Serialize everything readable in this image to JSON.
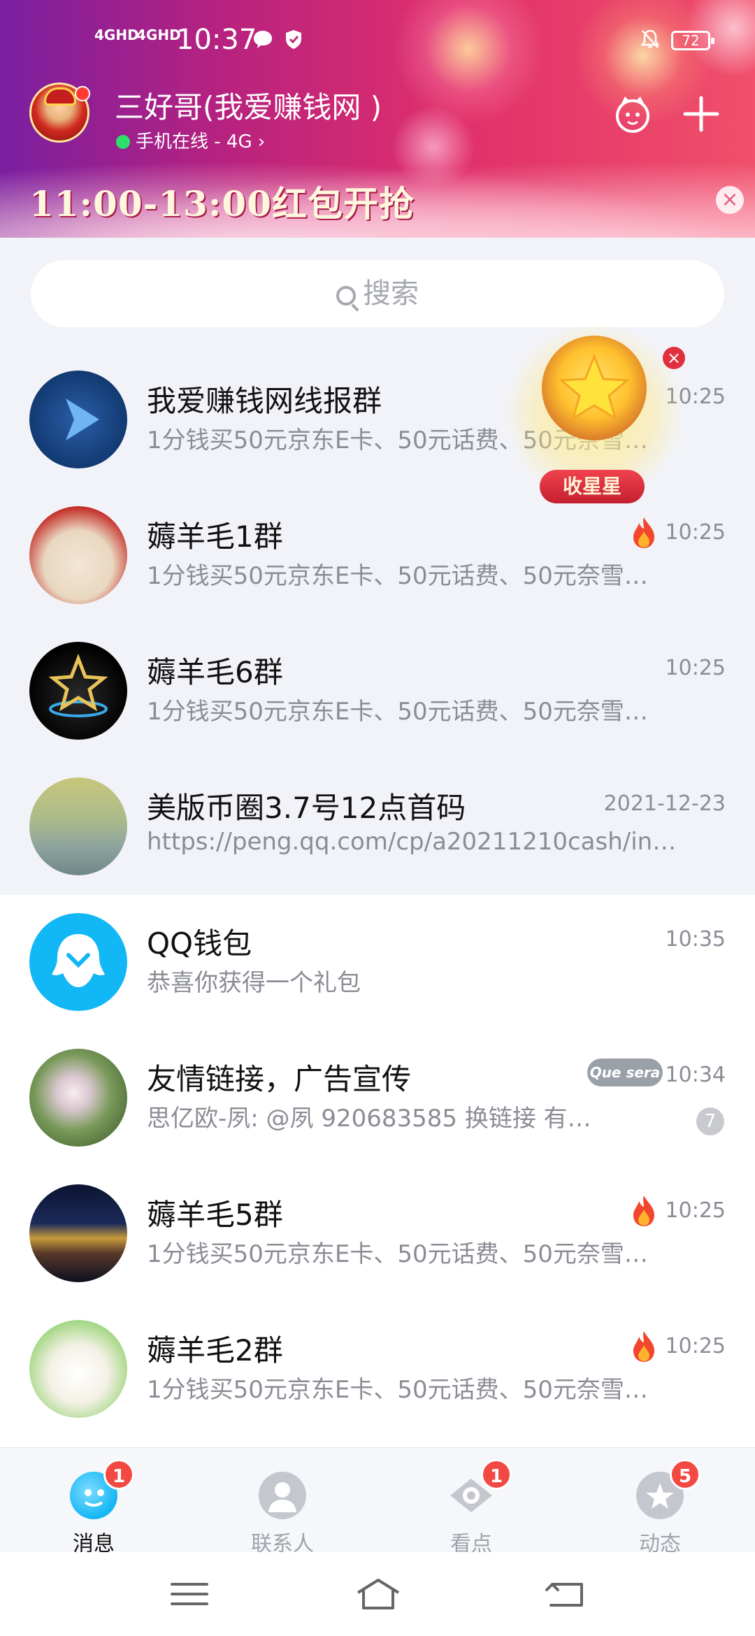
{
  "status_bar": {
    "network1": "4GHD",
    "network2": "4GHD",
    "time": "10:37",
    "battery": "72"
  },
  "header": {
    "nickname": "三好哥(我爱赚钱网 )",
    "online_status": "手机在线 - 4G",
    "banner_text": "11:00-13:00红包开抢",
    "close_glyph": "×"
  },
  "search": {
    "placeholder": "搜索"
  },
  "widget": {
    "label": "收星星",
    "close_glyph": "×"
  },
  "chats": [
    {
      "title": "我爱赚钱网线报群",
      "preview": "1分钱买50元京东E卡、50元话费、50元奈雪…",
      "time": "10:25"
    },
    {
      "title": "薅羊毛1群",
      "preview": "1分钱买50元京东E卡、50元话费、50元奈雪…",
      "time": "10:25"
    },
    {
      "title": "薅羊毛6群",
      "preview": "1分钱买50元京东E卡、50元话费、50元奈雪…",
      "time": "10:25"
    },
    {
      "title": "美版币圈3.7号12点首码",
      "preview": "https://peng.qq.com/cp/a20211210cash/in…",
      "time": "2021-12-23"
    },
    {
      "title": "QQ钱包",
      "preview": "恭喜你获得一个礼包",
      "time": "10:35"
    },
    {
      "title": "友情链接，广告宣传",
      "preview": "思亿欧-夙: @夙 920683585  换链接 有…",
      "time": "10:34",
      "count": "7",
      "tag": "Que sera"
    },
    {
      "title": "薅羊毛5群",
      "preview": "1分钱买50元京东E卡、50元话费、50元奈雪…",
      "time": "10:25"
    },
    {
      "title": "薅羊毛2群",
      "preview": "1分钱买50元京东E卡、50元话费、50元奈雪…",
      "time": "10:25"
    }
  ],
  "tabs": [
    {
      "label": "消息",
      "badge": "1"
    },
    {
      "label": "联系人"
    },
    {
      "label": "看点",
      "badge": "1"
    },
    {
      "label": "动态",
      "badge": "5"
    }
  ],
  "colors": {
    "accent": "#12b7f5",
    "badge_red": "#f24a43",
    "banner_gold": "#fff6de"
  }
}
